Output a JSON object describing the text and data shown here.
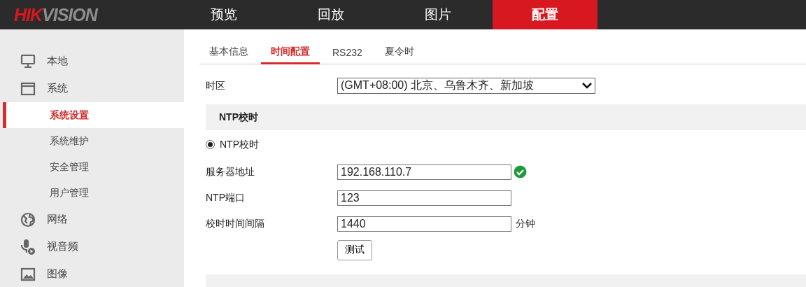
{
  "logo": [
    {
      "text": "HIK",
      "color": "#d71820"
    },
    {
      "text": "VISION",
      "color": "#8e8e8e"
    }
  ],
  "nav": [
    {
      "label": "预览",
      "selected": false
    },
    {
      "label": "回放",
      "selected": false
    },
    {
      "label": "图片",
      "selected": false
    },
    {
      "label": "配置",
      "selected": true
    }
  ],
  "sidebar": {
    "items": [
      {
        "label": "本地",
        "selected": false
      },
      {
        "label": "系统",
        "selected": false,
        "expanded": true,
        "children": [
          {
            "label": "系统设置",
            "selected": true
          },
          {
            "label": "系统维护",
            "selected": false
          },
          {
            "label": "安全管理",
            "selected": false
          },
          {
            "label": "用户管理",
            "selected": false
          }
        ]
      },
      {
        "label": "网络",
        "selected": false
      },
      {
        "label": "视音频",
        "selected": false
      },
      {
        "label": "图像",
        "selected": false
      }
    ]
  },
  "tabs": [
    {
      "label": "基本信息",
      "selected": false
    },
    {
      "label": "时间配置",
      "selected": true
    },
    {
      "label": "RS232",
      "selected": false
    },
    {
      "label": "夏令时",
      "selected": false
    }
  ],
  "timezone": {
    "label": "时区",
    "value": "(GMT+08:00) 北京、乌鲁木齐、新加坡"
  },
  "ntp_section": {
    "title": "NTP校时",
    "radio": {
      "label": "NTP校时",
      "checked": true
    },
    "fields": [
      {
        "label": "服务器地址",
        "value": "192.168.110.7",
        "valid": true
      },
      {
        "label": "NTP端口",
        "value": "123"
      },
      {
        "label": "校时时间间隔",
        "value": "1440",
        "unit": "分钟"
      }
    ],
    "test_button": "测试"
  }
}
